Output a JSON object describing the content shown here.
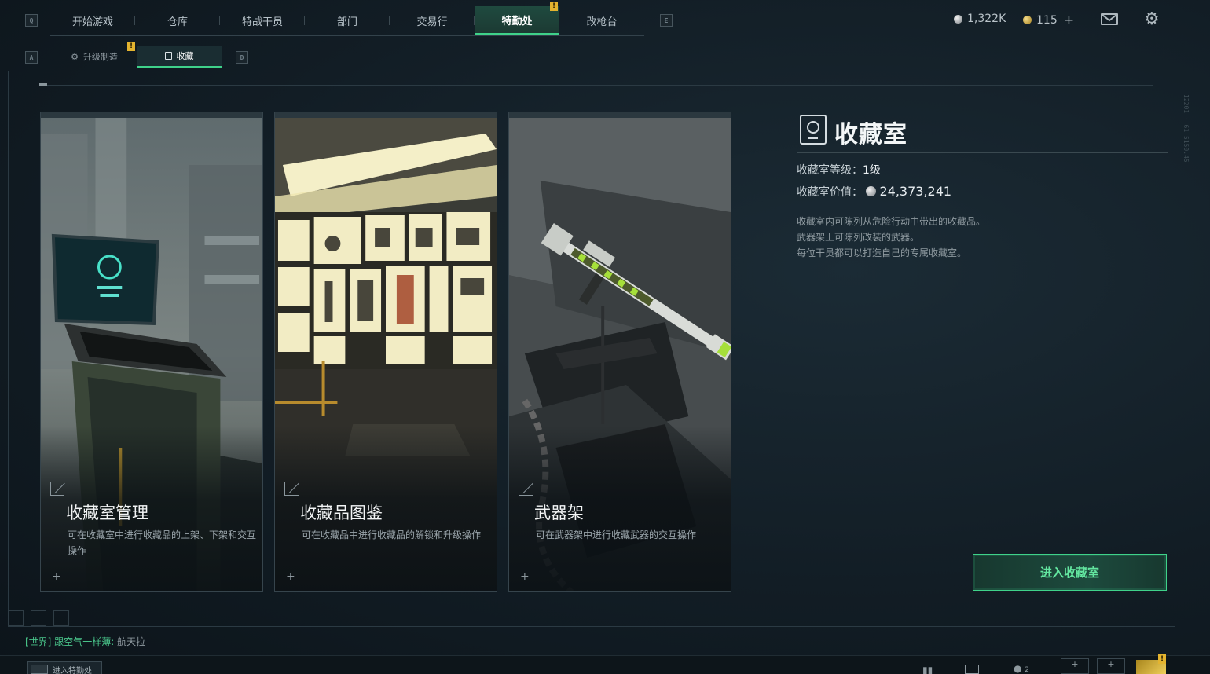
{
  "hotkeys": {
    "left_nav": "Q",
    "right_nav": "E",
    "sub_left": "A",
    "sub_right": "D"
  },
  "topnav": {
    "tabs": [
      {
        "label": "开始游戏",
        "active": false
      },
      {
        "label": "仓库",
        "active": false
      },
      {
        "label": "特战干员",
        "active": false
      },
      {
        "label": "部门",
        "active": false
      },
      {
        "label": "交易行",
        "active": false
      },
      {
        "label": "特勤处",
        "active": true,
        "alert": "!"
      },
      {
        "label": "改枪台",
        "active": false
      }
    ]
  },
  "subnav": {
    "tabs": [
      {
        "label": "升级制造",
        "alert": "!",
        "icon": "gear-arrow-icon"
      },
      {
        "label": "收藏",
        "active": true,
        "icon": "collection-icon"
      }
    ]
  },
  "currency": {
    "silver": "1,322K",
    "gold": "115",
    "add": "+"
  },
  "cards": [
    {
      "title": "收藏室管理",
      "desc": "可在收藏室中进行收藏品的上架、下架和交互操作",
      "scene": "terminal"
    },
    {
      "title": "收藏品图鉴",
      "desc": "可在收藏品中进行收藏品的解锁和升级操作",
      "scene": "showcase"
    },
    {
      "title": "武器架",
      "desc": "可在武器架中进行收藏武器的交互操作",
      "scene": "rifle"
    }
  ],
  "info": {
    "title": "收藏室",
    "level_label": "收藏室等级：",
    "level_value": "1级",
    "value_label": "收藏室价值：",
    "value_value": "24,373,241",
    "desc_lines": [
      "收藏室内可陈列从危险行动中带出的收藏品。",
      "武器架上可陈列改装的武器。",
      "每位干员都可以打造自己的专属收藏室。"
    ],
    "enter_button": "进入收藏室"
  },
  "chat": {
    "channel": "[世界]",
    "message": "跟空气一样薄:",
    "name": "航天拉"
  },
  "bottom": {
    "enter_label": "进入特勤处",
    "count": "2"
  },
  "colors": {
    "accent": "#3fd28a",
    "active_tab_bg": "#1f4a3f",
    "alert": "#e4b42f"
  }
}
